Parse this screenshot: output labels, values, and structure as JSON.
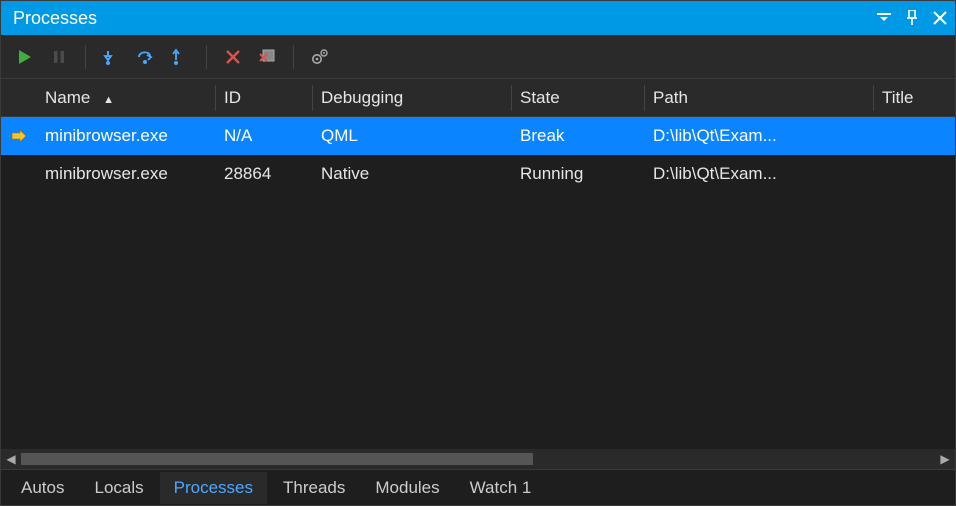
{
  "titlebar": {
    "title": "Processes"
  },
  "columns": {
    "name": "Name",
    "id": "ID",
    "debugging": "Debugging",
    "state": "State",
    "path": "Path",
    "title": "Title"
  },
  "rows": [
    {
      "name": "minibrowser.exe",
      "id": "N/A",
      "debugging": "QML",
      "state": "Break",
      "path": "D:\\lib\\Qt\\Exam...",
      "title": "",
      "current": true,
      "selected": true
    },
    {
      "name": "minibrowser.exe",
      "id": "28864",
      "debugging": "Native",
      "state": "Running",
      "path": "D:\\lib\\Qt\\Exam...",
      "title": "",
      "current": false,
      "selected": false
    }
  ],
  "tabs": {
    "autos": "Autos",
    "locals": "Locals",
    "processes": "Processes",
    "threads": "Threads",
    "modules": "Modules",
    "watch1": "Watch 1"
  },
  "colors": {
    "titlebar_bg": "#0099e6",
    "selection_bg": "#0a84ff",
    "panel_bg": "#1e1e1e"
  }
}
